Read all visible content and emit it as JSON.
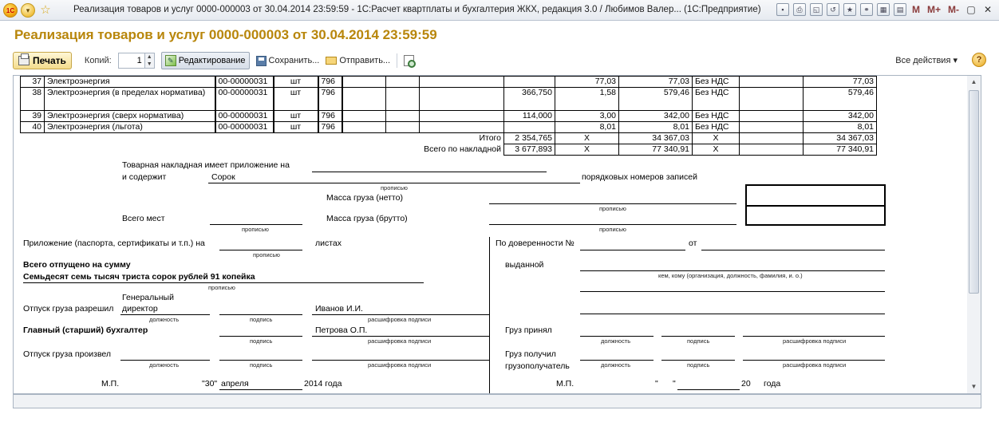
{
  "window": {
    "title": "Реализация товаров и услуг 0000-000003 от 30.04.2014 23:59:59 - 1С:Расчет квартплаты и бухгалтерия ЖКХ, редакция 3.0 / Любимов Валер... (1С:Предприятие)",
    "m_buttons": [
      "M",
      "M+",
      "M-"
    ]
  },
  "header": {
    "title": "Реализация товаров и услуг 0000-000003 от 30.04.2014 23:59:59"
  },
  "toolbar": {
    "print_label": "Печать",
    "copies_label": "Копий:",
    "copies_value": "1",
    "edit_label": "Редактирование",
    "save_label": "Сохранить...",
    "send_label": "Отправить...",
    "all_actions_label": "Все действия ▾"
  },
  "table": {
    "rows": [
      {
        "n": "37",
        "name": "Электроэнергия",
        "code": "00-00000031",
        "unit": "шт",
        "okei": "796",
        "qty": "",
        "price": "77,03",
        "sum": "77,03",
        "vat": "Без НДС",
        "total": "77,03"
      },
      {
        "n": "38",
        "name": "Электроэнергия (в пределах нормативa)",
        "code": "00-00000031",
        "unit": "шт",
        "okei": "796",
        "qty": "366,750",
        "price": "1,58",
        "sum": "579,46",
        "vat": "Без НДС",
        "total": "579,46"
      },
      {
        "n": "39",
        "name": "Электроэнергия (сверх норматива)",
        "code": "00-00000031",
        "unit": "шт",
        "okei": "796",
        "qty": "114,000",
        "price": "3,00",
        "sum": "342,00",
        "vat": "Без НДС",
        "total": "342,00"
      },
      {
        "n": "40",
        "name": "Электроэнергия (льгота)",
        "code": "00-00000031",
        "unit": "шт",
        "okei": "796",
        "qty": "",
        "price": "8,01",
        "sum": "8,01",
        "vat": "Без НДС",
        "total": "8,01"
      }
    ],
    "itogo": {
      "label": "Итого",
      "qty": "2 354,765",
      "x1": "X",
      "sum": "34 367,03",
      "x2": "X",
      "total": "34 367,03"
    },
    "vsego": {
      "label": "Всего по накладной",
      "qty": "3 677,893",
      "x1": "X",
      "sum": "77 340,91",
      "x2": "X",
      "total": "77 340,91"
    }
  },
  "form": {
    "app_label_1": "Товарная накладная имеет приложение на",
    "app_label_2": "и содержит",
    "count_words": "Сорок",
    "records_label": "порядковых номеров записей",
    "propisyu": "прописью",
    "mass_net": "Масса груза (нетто)",
    "mass_gross": "Масса груза (брутто)",
    "total_places": "Всего мест",
    "attachment": "Приложение (паспорта, сертификаты и т.п.) на",
    "sheets": "листах",
    "released_sum_label": "Всего отпущено  на сумму",
    "released_sum_words": "Семьдесят семь тысяч триста сорок рублей 91 копейка",
    "release_allowed": "Отпуск груза разрешил",
    "director_position": "Генеральный директор",
    "director_name": "Иванов И.И.",
    "chief_accountant": "Главный (старший) бухгалтер",
    "accountant_name": "Петрова О.П.",
    "release_made": "Отпуск груза произвел",
    "cap_position": "должность",
    "cap_signature": "подпись",
    "cap_decoding": "расшифровка подписи",
    "mp": "М.П.",
    "date_day": "\"30\"",
    "date_month": "апреля",
    "date_year": "2014 года",
    "power_of_attorney": "По доверенности №",
    "from": "от",
    "issued": "выданной",
    "issued_hint": "кем, кому (организация, должность, фамилия, и. о.)",
    "cargo_accepted": "Груз принял",
    "cargo_received_1": "Груз получил",
    "cargo_received_2": "грузополучатель",
    "mp_right": "М.П.",
    "quote_open": "\"",
    "quote_close": "\"",
    "year_prefix": "20",
    "year_suffix": "года"
  }
}
